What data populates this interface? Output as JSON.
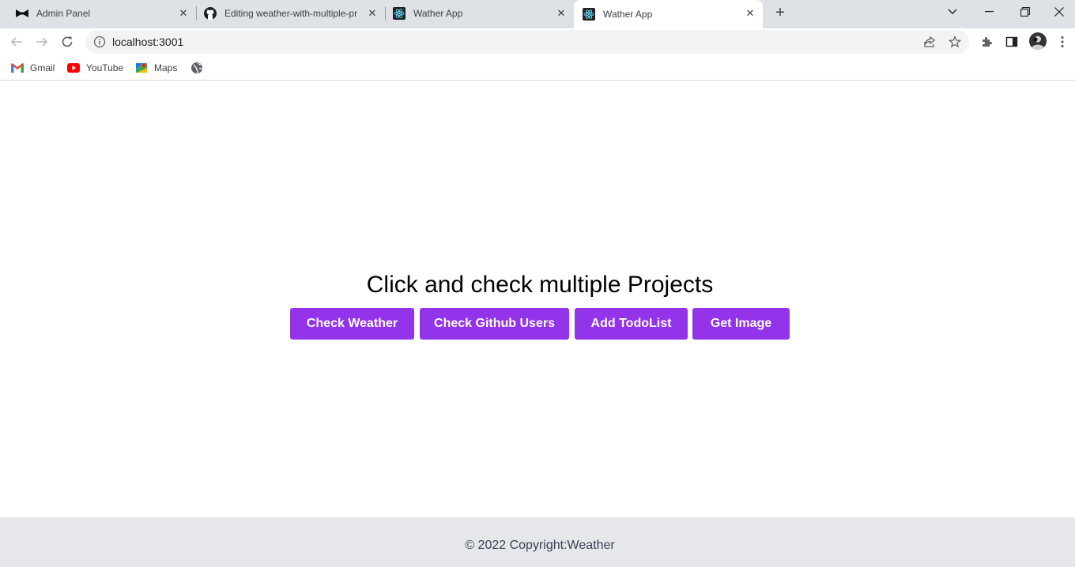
{
  "tabs": [
    {
      "title": "Admin Panel",
      "icon": "bowtie-icon"
    },
    {
      "title": "Editing weather-with-multiple-pr",
      "icon": "github-icon"
    },
    {
      "title": "Wather App",
      "icon": "react-icon"
    },
    {
      "title": "Wather App",
      "icon": "react-icon",
      "active": true
    }
  ],
  "toolbar": {
    "url": "localhost:3001"
  },
  "bookmarks": [
    {
      "label": "Gmail",
      "icon": "gmail-icon"
    },
    {
      "label": "YouTube",
      "icon": "youtube-icon"
    },
    {
      "label": "Maps",
      "icon": "maps-icon"
    },
    {
      "label": "",
      "icon": "globe-icon"
    }
  ],
  "main": {
    "heading": "Click and check multiple Projects",
    "buttons": [
      {
        "label": "Check Weather"
      },
      {
        "label": "Check Github Users"
      },
      {
        "label": "Add TodoList"
      },
      {
        "label": "Get Image"
      }
    ]
  },
  "footer": {
    "text": "© 2022 Copyright:Weather"
  },
  "colors": {
    "accent": "#9333ea",
    "footer_bg": "#e5e7eb",
    "tabstrip_bg": "#dee1e6"
  }
}
